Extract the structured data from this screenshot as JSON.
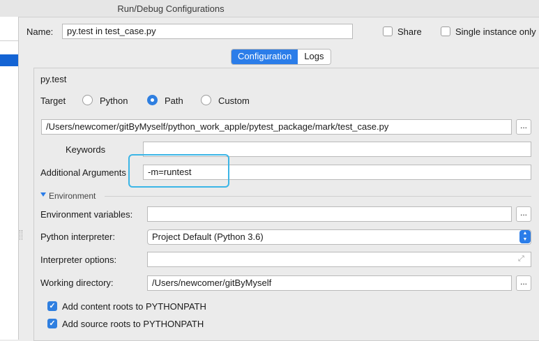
{
  "window": {
    "title": "Run/Debug Configurations"
  },
  "header": {
    "name_label": "Name:",
    "name_value": "py.test in test_case.py",
    "share_label": "Share",
    "single_instance_label": "Single instance only"
  },
  "tabs": [
    {
      "label": "Configuration",
      "active": true
    },
    {
      "label": "Logs",
      "active": false
    }
  ],
  "config": {
    "section_title": "py.test",
    "target_label": "Target",
    "target_options": [
      "Python",
      "Path",
      "Custom"
    ],
    "target_selected": "Path",
    "path_value": "/Users/newcomer/gitByMyself/python_work_apple/pytest_package/mark/test_case.py",
    "browse_label": "...",
    "keywords_label": "Keywords",
    "keywords_value": "",
    "additional_args_label": "Additional Arguments",
    "additional_args_value": "-m=runtest",
    "environment_label": "Environment",
    "env_vars_label": "Environment variables:",
    "env_vars_value": "",
    "interpreter_label": "Python interpreter:",
    "interpreter_value": "Project Default (Python 3.6)",
    "interp_options_label": "Interpreter options:",
    "interp_options_value": "",
    "workdir_label": "Working directory:",
    "workdir_value": "/Users/newcomer/gitByMyself",
    "add_content_roots_label": "Add content roots to PYTHONPATH",
    "add_source_roots_label": "Add source roots to PYTHONPATH"
  },
  "colors": {
    "accent": "#2b7de9",
    "highlight": "#3bb5e6",
    "selection": "#1464d4"
  },
  "icons": {
    "expand": "triangle-down-icon",
    "check": "checkmark-icon",
    "combo": "updown-arrows-icon",
    "resize": "expand-arrows-icon"
  }
}
